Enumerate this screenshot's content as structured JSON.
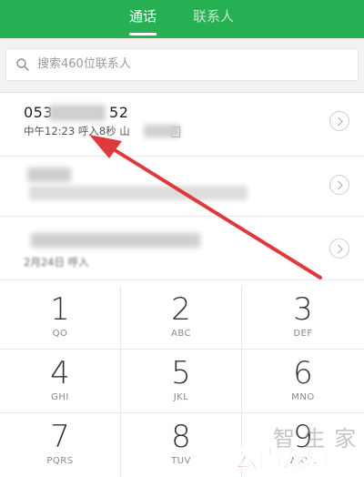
{
  "header": {
    "tab_calls": "通话",
    "tab_contacts": "联系人"
  },
  "search": {
    "placeholder": "搜索460位联系人"
  },
  "calls": [
    {
      "number_start": "053",
      "number_end": "52",
      "time": "中午12:23",
      "type": "呼入",
      "duration": "8秒",
      "location": "山",
      "sim": "1"
    },
    {
      "date": "2月24日 呼入"
    }
  ],
  "dialpad": [
    {
      "digit": "1",
      "letters": "QO"
    },
    {
      "digit": "2",
      "letters": "ABC"
    },
    {
      "digit": "3",
      "letters": "DEF"
    },
    {
      "digit": "4",
      "letters": "GHI"
    },
    {
      "digit": "5",
      "letters": "JKL"
    },
    {
      "digit": "6",
      "letters": "MNO"
    },
    {
      "digit": "7",
      "letters": "PQRS"
    },
    {
      "digit": "8",
      "letters": "TUV"
    },
    {
      "digit": "9",
      "letters": "WXYZ"
    }
  ],
  "watermark": {
    "top": "智 生 家",
    "bottom": "云南龙网"
  },
  "colors": {
    "header": "#27b053",
    "arrow": "#e0393c"
  }
}
